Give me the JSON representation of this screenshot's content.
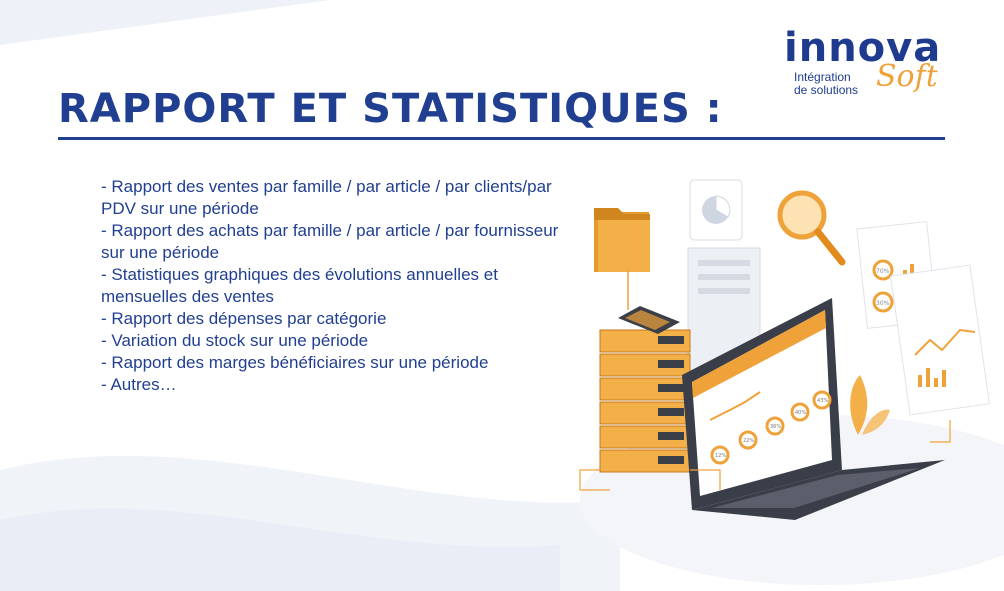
{
  "brand": {
    "name_main": "innova",
    "name_accent": "Soft",
    "tagline_line1": "Intégration",
    "tagline_line2": "de solutions",
    "primary_color": "#213f91",
    "accent_color": "#f0a23a"
  },
  "title": "RAPPORT ET STATISTIQUES :",
  "features": [
    "- Rapport des ventes par famille / par article / par clients/par PDV sur une période",
    "- Rapport des achats par famille / par article / par fournisseur sur une période",
    "- Statistiques graphiques des évolutions annuelles et mensuelles des ventes",
    "- Rapport des dépenses par catégorie",
    "- Variation du stock sur une période",
    "- Rapport des marges bénéficiaires sur une période",
    "- Autres…"
  ],
  "illustration": {
    "icons": [
      "folder-icon",
      "pie-chart-icon",
      "magnifier-icon",
      "server-stack-icon",
      "laptop-icon",
      "report-document-icon",
      "plant-icon"
    ],
    "donut_labels": [
      "12%",
      "22%",
      "36%",
      "40%",
      "43%",
      "70%",
      "30%"
    ]
  }
}
